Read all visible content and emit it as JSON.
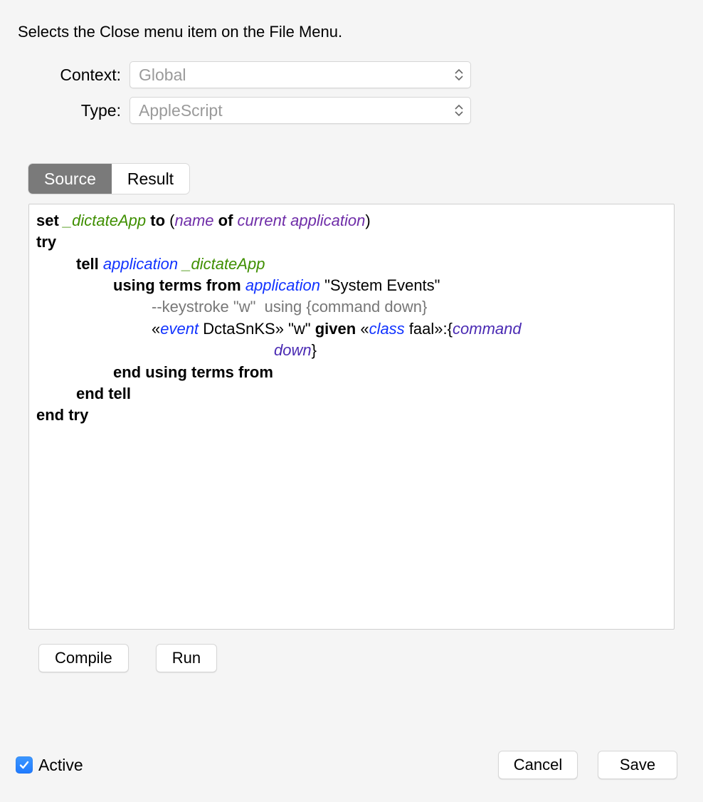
{
  "description": "Selects the Close menu item on the File Menu.",
  "form": {
    "context_label": "Context:",
    "context_value": "Global",
    "type_label": "Type:",
    "type_value": "AppleScript"
  },
  "tabs": {
    "source": "Source",
    "result": "Result"
  },
  "code": {
    "kw_set": "set",
    "var_dictateApp": "_dictateApp",
    "kw_to": "to",
    "kw_name": "name",
    "kw_of": "of",
    "curr_app": "current application",
    "kw_try": "try",
    "kw_tell": "tell",
    "kw_application": "application",
    "kw_using_terms_from": "using terms from",
    "str_sysevents": "\"System Events\"",
    "comment_line": "--keystroke \"w\"  using {command down}",
    "guillemet_open": "«",
    "guillemet_close": "»",
    "kw_event": "event",
    "raw_event": "DctaSnKS",
    "str_w": "\"w\"",
    "kw_given": "given",
    "kw_class": "class",
    "raw_class": "faal",
    "colon_brace": ":{",
    "cmd_down": "command down",
    "brace_close": "}",
    "kw_end_using": "end using terms from",
    "kw_end_tell": "end tell",
    "kw_end_try": "end try"
  },
  "buttons": {
    "compile": "Compile",
    "run": "Run",
    "cancel": "Cancel",
    "save": "Save"
  },
  "footer": {
    "active_label": "Active",
    "active_checked": true
  }
}
